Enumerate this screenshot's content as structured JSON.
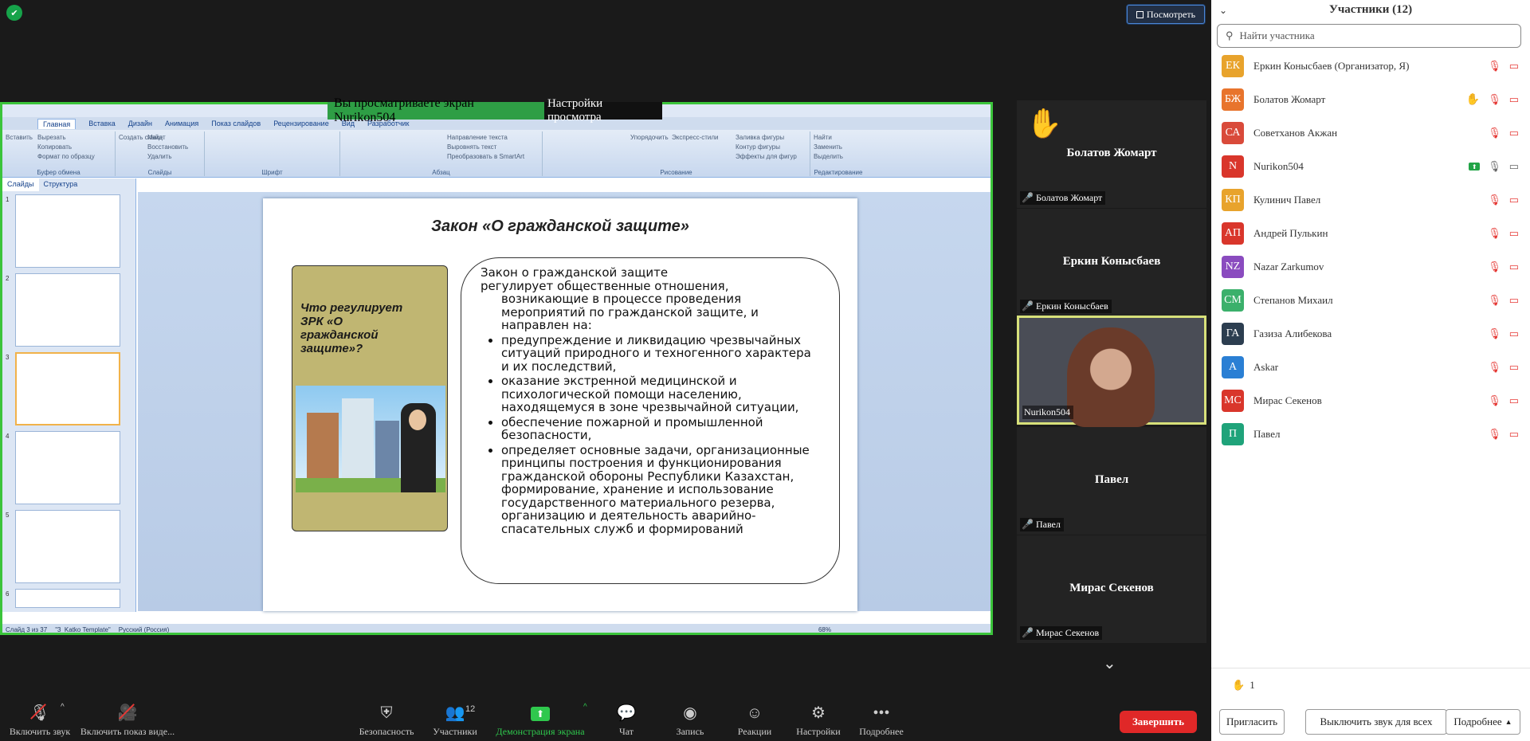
{
  "top": {
    "view_button": "Посмотреть"
  },
  "banner": {
    "viewing": "Вы просматриваете экран Nurikon504",
    "settings": "Настройки просмотра"
  },
  "ppt": {
    "tabs": [
      "Главная",
      "Вставка",
      "Дизайн",
      "Анимация",
      "Показ слайдов",
      "Рецензирование",
      "Вид",
      "Разработчик"
    ],
    "groups": {
      "clipboard": {
        "caption": "Буфер обмена",
        "paste": "Вставить",
        "cut": "Вырезать",
        "copy": "Копировать",
        "format": "Формат по образцу"
      },
      "slides": {
        "caption": "Слайды",
        "create": "Создать слайд",
        "layout": "Макет",
        "restore": "Восстановить",
        "delete": "Удалить"
      },
      "font": {
        "caption": "Шрифт"
      },
      "paragraph": {
        "caption": "Абзац",
        "direction": "Направление текста",
        "align": "Выровнять текст",
        "smartart": "Преобразовать в SmartArt"
      },
      "drawing": {
        "caption": "Рисование",
        "arrange": "Упорядочить",
        "styles": "Экспресс-стили",
        "fill": "Заливка фигуры",
        "outline": "Контур фигуры",
        "effects": "Эффекты для фигур"
      },
      "editing": {
        "caption": "Редактирование",
        "find": "Найти",
        "replace": "Заменить",
        "select": "Выделить"
      }
    },
    "pane_tabs": {
      "slides": "Слайды",
      "outline": "Структура"
    },
    "status": {
      "slide": "Слайд 3 из 37",
      "theme": "\"3_Katko Template\"",
      "lang": "Русский (Россия)",
      "zoom": "68%"
    }
  },
  "slide": {
    "title": "Закон «О гражданской защите»",
    "question": "Что регулирует ЗРК «О гражданской защите»?",
    "intro_1": "Закон о гражданской защите",
    "intro_2": "регулирует общественные отношения,",
    "intro_3": "возникающие в процессе проведения мероприятий по гражданской защите, и направлен на:",
    "bullets": [
      "предупреждение и ликвидацию чрезвычайных ситуаций природного и техногенного характера и их последствий,",
      "оказание экстренной медицинской и психологической помощи населению, находящемуся в зоне чрезвычайной ситуации,",
      "обеспечение пожарной и промышленной безопасности,",
      "определяет основные задачи, организационные принципы построения и функционирования гражданской обороны Республики Казахстан, формирование, хранение и использование государственного материального резерва, организацию и деятельность аварийно-спасательных служб и формирований"
    ]
  },
  "tiles": [
    {
      "name": "Болатов Жомарт",
      "label": "Болатов Жомарт"
    },
    {
      "name": "Еркин Конысбаев",
      "label": "Еркин Конысбаев"
    },
    {
      "label": "Nurikon504"
    },
    {
      "name": "Павел",
      "label": "Павел"
    },
    {
      "name": "Мирас Секенов",
      "label": "Мирас Секенов"
    }
  ],
  "panel": {
    "title": "Участники (12)",
    "search_placeholder": "Найти участника",
    "participants": [
      {
        "initials": "ЕК",
        "name": "Еркин Конысбаев (Организатор, Я)",
        "color": "#e8a32c"
      },
      {
        "initials": "БЖ",
        "name": "Болатов Жомарт",
        "color": "#e8742c"
      },
      {
        "initials": "СА",
        "name": "Советханов Акжан",
        "color": "#d94a3a"
      },
      {
        "initials": "N",
        "name": "Nurikon504",
        "color": "#d9362b"
      },
      {
        "initials": "КП",
        "name": "Кулинич Павел",
        "color": "#e8a32c"
      },
      {
        "initials": "АП",
        "name": "Андрей Пулькин",
        "color": "#d9362b"
      },
      {
        "initials": "NZ",
        "name": "Nazar Zarkumov",
        "color": "#8a4bbf"
      },
      {
        "initials": "СМ",
        "name": "Степанов Михаил",
        "color": "#3bb06b"
      },
      {
        "initials": "ГА",
        "name": "Газиза Алибекова",
        "color": "#2c3e50"
      },
      {
        "initials": "A",
        "name": "Askar",
        "color": "#2a7fd4"
      },
      {
        "initials": "МС",
        "name": "Мирас Секенов",
        "color": "#d9362b"
      },
      {
        "initials": "П",
        "name": "Павел",
        "color": "#1fa37a"
      }
    ],
    "raised_count": "1",
    "buttons": {
      "invite": "Пригласить",
      "mute_all": "Выключить звук для всех",
      "more": "Подробнее"
    }
  },
  "toolbar": {
    "mic": "Включить звук",
    "video": "Включить показ виде...",
    "security": "Безопасность",
    "participants": "Участники",
    "participants_count": "12",
    "share": "Демонстрация экрана",
    "chat": "Чат",
    "record": "Запись",
    "reactions": "Реакции",
    "settings": "Настройки",
    "more": "Подробнее",
    "end": "Завершить"
  }
}
